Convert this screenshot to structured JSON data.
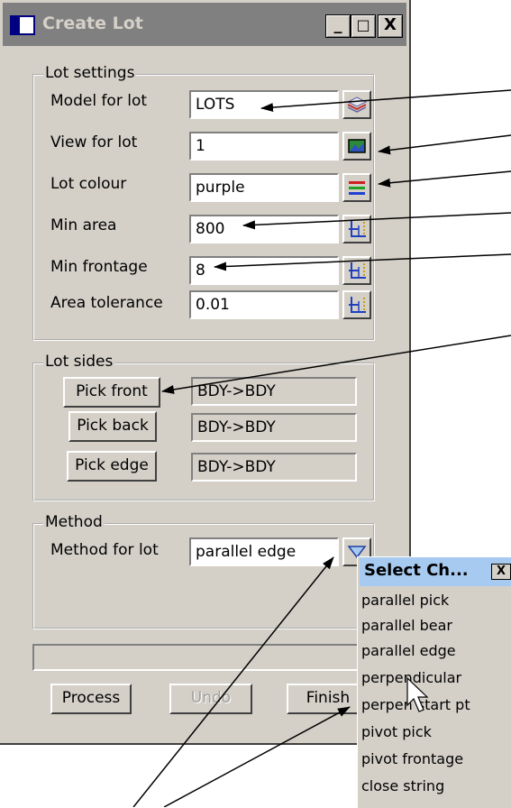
{
  "window": {
    "title": "Create Lot",
    "minimize": "_",
    "maximize": "□",
    "close": "X"
  },
  "lot_settings": {
    "group_label": "Lot settings",
    "fields": [
      {
        "label": "Model for lot",
        "value": "LOTS",
        "icon": "layers-icon"
      },
      {
        "label": "View for lot",
        "value": "1",
        "icon": "view-picture-icon"
      },
      {
        "label": "Lot colour",
        "value": "purple",
        "icon": "colour-bars-icon"
      },
      {
        "label": "Min area",
        "value": "800",
        "icon": "number-ruler-icon"
      },
      {
        "label": "Min frontage",
        "value": "8",
        "icon": "number-ruler-icon"
      },
      {
        "label": "Area tolerance",
        "value": "0.01",
        "icon": "number-ruler-icon"
      }
    ]
  },
  "lot_sides": {
    "group_label": "Lot sides",
    "rows": [
      {
        "button": "Pick front",
        "value": "BDY->BDY"
      },
      {
        "button": "Pick back",
        "value": "BDY->BDY"
      },
      {
        "button": "Pick edge",
        "value": "BDY->BDY"
      }
    ]
  },
  "method": {
    "group_label": "Method",
    "label": "Method for lot",
    "value": "parallel edge",
    "icon": "dropdown-triangle-icon"
  },
  "buttons": {
    "process": "Process",
    "undo": "Undo",
    "finish": "Finish"
  },
  "popup": {
    "title": "Select Ch...",
    "close": "X",
    "items": [
      "parallel pick",
      "parallel bear",
      "parallel edge",
      "perpendicular",
      "perpen start pt",
      "pivot pick",
      "pivot frontage",
      "close string"
    ]
  },
  "colors": {
    "dialog_bg": "#d4d0c8",
    "titlebar_inactive": "#808080",
    "popup_titlebar": "#a6caf0"
  }
}
